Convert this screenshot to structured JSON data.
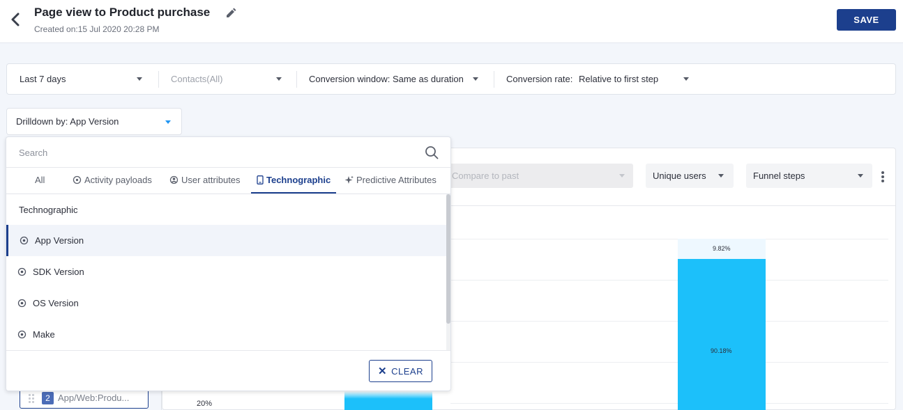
{
  "header": {
    "title": "Page view to Product purchase",
    "created": "Created on:15 Jul 2020 20:28 PM",
    "save_label": "SAVE"
  },
  "filters": {
    "date_range": "Last 7 days",
    "contacts": "Contacts(All)",
    "conversion_window": "Conversion window: Same as duration",
    "conversion_rate_label": "Conversion rate:",
    "conversion_rate_value": "Relative to first step"
  },
  "drilldown": {
    "label": "Drilldown by: App Version"
  },
  "dropdown": {
    "search_placeholder": "Search",
    "tabs": [
      {
        "label": "All",
        "icon": "none"
      },
      {
        "label": "Activity payloads",
        "icon": "payload-icon"
      },
      {
        "label": "User attributes",
        "icon": "user-attribute-icon"
      },
      {
        "label": "Technographic",
        "icon": "device-icon",
        "active": true
      },
      {
        "label": "Predictive Attributes",
        "icon": "sparkle-icon"
      }
    ],
    "section_title": "Technographic",
    "options": [
      {
        "label": "App Version",
        "selected": true
      },
      {
        "label": "SDK Version"
      },
      {
        "label": "OS Version"
      },
      {
        "label": "Make"
      }
    ],
    "clear_label": "CLEAR"
  },
  "chart_controls": {
    "compare": "Compare to past",
    "metric": "Unique users",
    "view": "Funnel steps"
  },
  "chart_data": {
    "type": "bar",
    "bar_labels": [
      "9.82%",
      "90.18%"
    ],
    "ytick_visible": "20%"
  },
  "funnel_step": {
    "number": "2",
    "label": "App/Web:Produ..."
  },
  "colors": {
    "primary": "#1c3f8d",
    "bar": "#1cc0fa"
  }
}
